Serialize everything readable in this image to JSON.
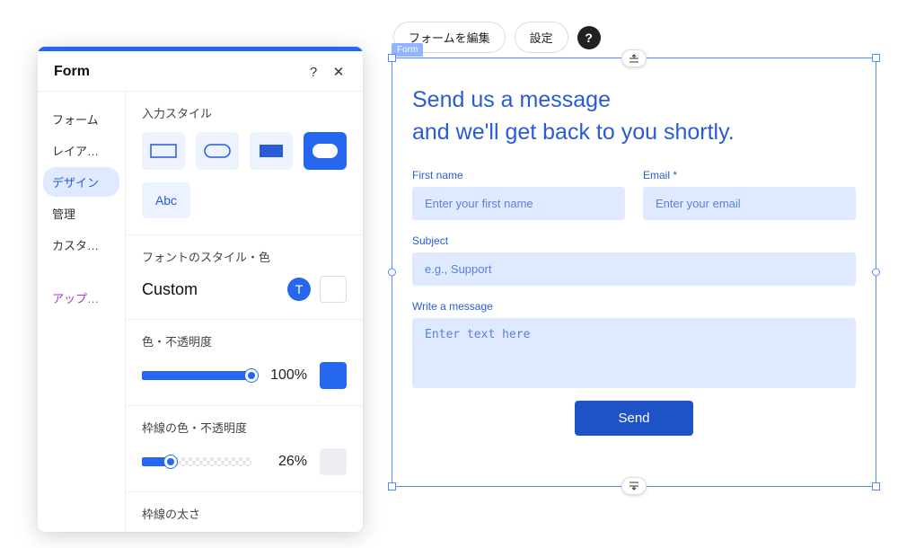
{
  "panel": {
    "title": "Form",
    "help_icon": "?",
    "close_icon": "✕",
    "tabs": {
      "form": "フォーム",
      "layout": "レイア…",
      "design": "デザイン",
      "manage": "管理",
      "custom": "カスタ…",
      "upgrade": "アップ…"
    },
    "section_input_style": "入力スタイル",
    "abc_label": "Abc",
    "section_font": "フォントのスタイル・色",
    "font_name": "Custom",
    "font_T": "T",
    "section_color_opacity": "色・不透明度",
    "opacity1": "100%",
    "section_border_color": "枠線の色・不透明度",
    "opacity2": "26%",
    "section_border_weight": "枠線の太さ"
  },
  "toolbar": {
    "edit_form": "フォームを編集",
    "settings": "設定",
    "help": "?"
  },
  "canvas": {
    "label": "Form",
    "title": "Send us a message\nand we'll get back to you shortly.",
    "first_name_label": "First name",
    "first_name_ph": "Enter your first name",
    "email_label": "Email *",
    "email_ph": "Enter your email",
    "subject_label": "Subject",
    "subject_ph": "e.g., Support",
    "message_label": "Write a message",
    "message_ph": "Enter text here",
    "send": "Send"
  }
}
